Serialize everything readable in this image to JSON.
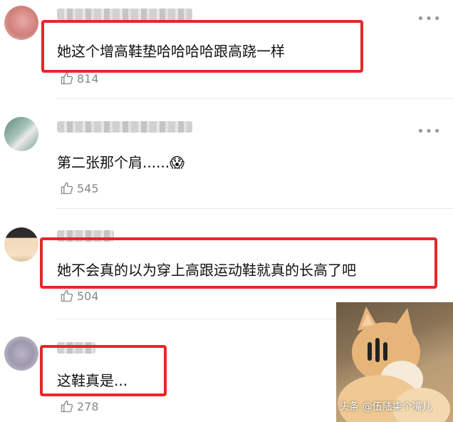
{
  "comments": [
    {
      "text": "她这个增高鞋垫哈哈哈哈跟高跷一样",
      "likes": "814",
      "more": "•••"
    },
    {
      "text": "第二张那个肩......😱",
      "likes": "545",
      "more": "•••"
    },
    {
      "text": "她不会真的以为穿上高跟运动鞋就真的长高了吧",
      "likes": "504",
      "more": ""
    },
    {
      "text": "这鞋真是...",
      "likes": "278",
      "more": ""
    }
  ],
  "watermark": "头条 @伍陆柒个嘴儿",
  "colors": {
    "highlight": "#e8262a",
    "text": "#111111",
    "meta": "#888888"
  },
  "icons": {
    "like": "thumbs-up-icon",
    "more": "more-dots-icon"
  }
}
